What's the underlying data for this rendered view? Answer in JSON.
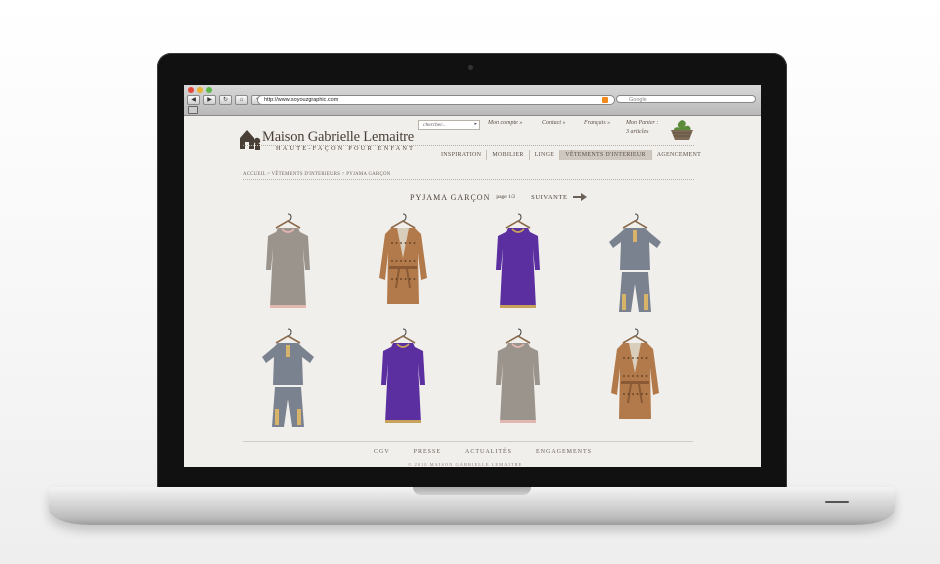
{
  "browser": {
    "url": "http://www.soyouzgraphic.com",
    "search_placeholder": "Google",
    "buttons": [
      "◀",
      "▶",
      "↻",
      "⌂",
      "+"
    ],
    "colors": {
      "close": "#e5483d",
      "minimize": "#e9b22f",
      "maximize": "#5bb74a"
    }
  },
  "site": {
    "brand_name": "Maison Gabrielle Lemaitre",
    "brand_tagline": "HAUTE-FAÇON POUR ENFANT",
    "search_placeholder": "chercher...",
    "search_arrow": "▸",
    "account": "Mon compte »",
    "contact": "Contact »",
    "language": "Français »",
    "cart_label": "Mon Panier :",
    "cart_count": "3 articles",
    "menu": [
      "INSPIRATION",
      "MOBILIER",
      "LINGE",
      "VÊTEMENTS D'INTERIEUR",
      "AGENCEMENT"
    ],
    "active_menu": "VÊTEMENTS D'INTERIEUR",
    "breadcrumb": "ACCUEIL > VÊTEMENTS D'INTERIEURS > PYJAMA GARÇON",
    "page_title": "PYJAMA GARÇON",
    "page_indicator": "page 1/2",
    "next_label": "SUIVANTE",
    "products": [
      {
        "type": "dress",
        "color": "#9b948c",
        "trim": "#e2b7b0"
      },
      {
        "type": "robe",
        "color": "#b27a4a",
        "trim": "#d9cdbb"
      },
      {
        "type": "dress",
        "color": "#5b2fa0",
        "trim": "#c8a25a"
      },
      {
        "type": "pajama",
        "color": "#7a8290",
        "trim": "#d8b36a"
      },
      {
        "type": "pajama",
        "color": "#7a8290",
        "trim": "#d8b36a"
      },
      {
        "type": "dress",
        "color": "#5b2fa0",
        "trim": "#c8a25a"
      },
      {
        "type": "dress",
        "color": "#9b948c",
        "trim": "#e2b7b0"
      },
      {
        "type": "robe",
        "color": "#b27a4a",
        "trim": "#d9cdbb"
      }
    ],
    "footer_links": [
      "CGV",
      "PRESSE",
      "ACTUALITÉS",
      "ENGAGEMENTS"
    ],
    "copyright": "© 2010 MAISON GABRIELLE LEMAITRE"
  }
}
